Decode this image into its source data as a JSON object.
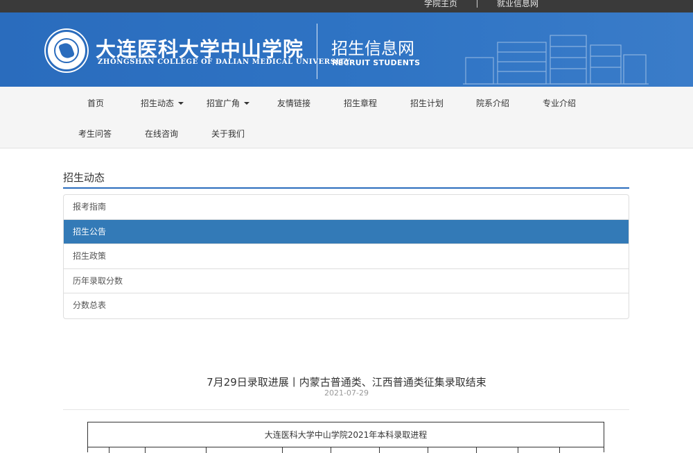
{
  "topbar": {
    "links": [
      "学院主页",
      "就业信息网"
    ]
  },
  "header": {
    "college_cn": "大连医科大学中山学院",
    "college_en": "ZHONGSHAN COLLEGE OF DALIAN MEDICAL UNIVERSITY",
    "site_cn": "招生信息网",
    "site_en": "RECRUIT STUDENTS"
  },
  "nav": {
    "row1": [
      {
        "label": "首页",
        "dropdown": false
      },
      {
        "label": "招生动态",
        "dropdown": true
      },
      {
        "label": "招宣广角",
        "dropdown": true
      },
      {
        "label": "友情链接",
        "dropdown": false
      },
      {
        "label": "招生章程",
        "dropdown": false
      },
      {
        "label": "招生计划",
        "dropdown": false
      },
      {
        "label": "院系介绍",
        "dropdown": false
      },
      {
        "label": "专业介绍",
        "dropdown": false
      }
    ],
    "row2": [
      {
        "label": "考生问答",
        "dropdown": false
      },
      {
        "label": "在线咨询",
        "dropdown": false
      },
      {
        "label": "关于我们",
        "dropdown": false
      }
    ]
  },
  "sidebar": {
    "title": "招生动态",
    "items": [
      {
        "label": "报考指南",
        "active": false
      },
      {
        "label": "招生公告",
        "active": true
      },
      {
        "label": "招生政策",
        "active": false
      },
      {
        "label": "历年录取分数",
        "active": false
      },
      {
        "label": "分数总表",
        "active": false
      }
    ]
  },
  "article": {
    "title": "7月29日录取进展丨内蒙古普通类、江西普通类征集录取结束",
    "date": "2021-07-29",
    "table_caption": "大连医科大学中山学院2021年本科录取进程"
  },
  "colors": {
    "banner": "#2a6cbd",
    "active_item": "#337ab7",
    "topbar": "#3a3a3a"
  }
}
